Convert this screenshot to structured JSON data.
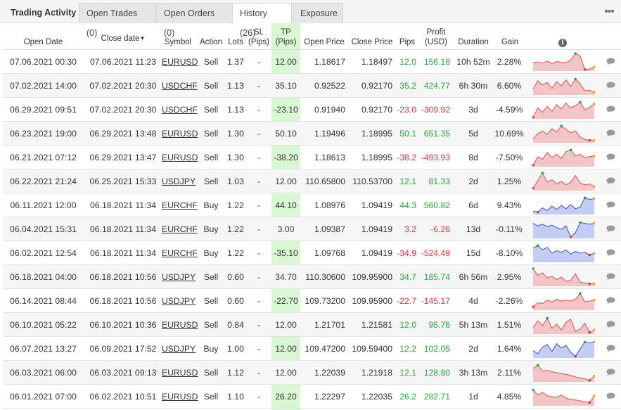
{
  "tabs": {
    "title": "Trading Activity",
    "items": [
      {
        "label": "Open Trades (0)",
        "active": false
      },
      {
        "label": "Open Orders (0)",
        "active": false
      },
      {
        "label": "History (26)",
        "active": true
      },
      {
        "label": "Exposure",
        "active": false
      }
    ],
    "more_icon": "more-dots-icon"
  },
  "columns": {
    "open_date": "Open Date",
    "close_date": "Close date",
    "sort_indicator": "▼",
    "symbol": "Symbol",
    "action": "Action",
    "lots": "Lots",
    "sl_1": "SL",
    "sl_2": "(Pips)",
    "tp_1": "TP",
    "tp_2": "(Pips)",
    "open_price": "Open Price",
    "close_price": "Close Price",
    "pips": "Pips",
    "profit_1": "Profit",
    "profit_2": "(USD)",
    "duration": "Duration",
    "gain": "Gain",
    "info_icon": "info-icon"
  },
  "colors": {
    "positive": "#2aa73a",
    "negative": "#e0393e",
    "tp_column_bg": "#d9f7d2",
    "sell_spark_line": "#d9534f",
    "sell_spark_fill": "#f2c6c6",
    "buy_spark_line": "#3a4fd1",
    "buy_spark_fill": "#c4cef2"
  },
  "rows": [
    {
      "open_date": "07.06.2021 00:30",
      "close_date": "07.06.2021 11:23",
      "symbol": "EURUSD",
      "action": "Sell",
      "lots": "1.37",
      "sl": "-",
      "tp": "12.00",
      "open_price": "1.18617",
      "close_price": "1.18497",
      "pips": "12.0",
      "profit": "156.18",
      "duration": "10h 52m",
      "gain": "2.28%",
      "sign": "pos",
      "spark": [
        0.45,
        0.5,
        0.42,
        0.55,
        0.4,
        0.52,
        0.48,
        0.46,
        0.6,
        1.0,
        0.85,
        0.05,
        0.08,
        0.2
      ]
    },
    {
      "open_date": "07.02.2021 14:00",
      "close_date": "07.02.2021 20:30",
      "symbol": "USDCHF",
      "action": "Sell",
      "lots": "1.13",
      "sl": "-",
      "tp": "35.10",
      "open_price": "0.92522",
      "close_price": "0.92170",
      "pips": "35.2",
      "profit": "424.77",
      "duration": "6h 30m",
      "gain": "6.60%",
      "sign": "pos",
      "spark": [
        0.3,
        0.8,
        0.55,
        0.7,
        0.35,
        0.75,
        0.5,
        0.85,
        0.45,
        0.9,
        0.6,
        0.2,
        0.25,
        0.1
      ]
    },
    {
      "open_date": "06.29.2021 09:51",
      "close_date": "07.02.2021 20:30",
      "symbol": "USDCHF",
      "action": "Sell",
      "lots": "1.13",
      "sl": "-",
      "tp": "-23.10",
      "open_price": "0.91940",
      "close_price": "0.92170",
      "pips": "-23.0",
      "profit": "-309.92",
      "duration": "3d",
      "gain": "-4.59%",
      "sign": "neg",
      "spark": [
        0.05,
        0.6,
        0.35,
        0.7,
        0.4,
        0.8,
        0.55,
        0.9,
        0.6,
        0.75,
        0.95,
        0.5,
        0.65,
        0.85
      ]
    },
    {
      "open_date": "06.23.2021 19:00",
      "close_date": "06.29.2021 13:48",
      "symbol": "EURUSD",
      "action": "Sell",
      "lots": "1.30",
      "sl": "-",
      "tp": "50.10",
      "open_price": "1.19496",
      "close_price": "1.18995",
      "pips": "50.1",
      "profit": "651.35",
      "duration": "5d",
      "gain": "10.69%",
      "sign": "pos",
      "spark": [
        0.2,
        0.5,
        0.65,
        0.45,
        0.8,
        0.6,
        0.95,
        0.75,
        0.55,
        0.65,
        0.3,
        0.15,
        0.1,
        0.1
      ]
    },
    {
      "open_date": "06.21.2021 07:12",
      "close_date": "06.29.2021 13:47",
      "symbol": "EURUSD",
      "action": "Sell",
      "lots": "1.30",
      "sl": "-",
      "tp": "-38.20",
      "open_price": "1.18613",
      "close_price": "1.18995",
      "pips": "-38.2",
      "profit": "-493.93",
      "duration": "8d",
      "gain": "-7.50%",
      "sign": "neg",
      "spark": [
        0.05,
        0.55,
        0.4,
        0.8,
        0.5,
        0.7,
        0.45,
        0.85,
        0.95,
        0.6,
        0.7,
        0.5,
        0.55,
        0.6
      ]
    },
    {
      "open_date": "06.22.2021 21:24",
      "close_date": "06.25.2021 15:33",
      "symbol": "USDJPY",
      "action": "Sell",
      "lots": "1.03",
      "sl": "-",
      "tp": "12.00",
      "open_price": "110.65800",
      "close_price": "110.53700",
      "pips": "12.1",
      "profit": "81.33",
      "duration": "2d",
      "gain": "1.25%",
      "sign": "pos",
      "spark": [
        0.1,
        0.55,
        1.0,
        0.45,
        0.6,
        0.35,
        0.5,
        0.3,
        0.45,
        0.85,
        0.4,
        0.3,
        0.35,
        0.2
      ]
    },
    {
      "open_date": "06.11.2021 12:00",
      "close_date": "06.18.2021 11:34",
      "symbol": "EURCHF",
      "action": "Buy",
      "lots": "1.22",
      "sl": "-",
      "tp": "44.10",
      "open_price": "1.08976",
      "close_price": "1.09419",
      "pips": "44.3",
      "profit": "560.82",
      "duration": "6d",
      "gain": "9.43%",
      "sign": "pos",
      "spark": [
        0.15,
        0.1,
        0.35,
        0.2,
        0.45,
        0.25,
        0.5,
        0.3,
        0.55,
        0.3,
        0.4,
        0.95,
        0.85,
        0.9
      ]
    },
    {
      "open_date": "06.04.2021 15:31",
      "close_date": "06.18.2021 11:34",
      "symbol": "EURCHF",
      "action": "Buy",
      "lots": "1.22",
      "sl": "-",
      "tp": "3.00",
      "open_price": "1.09387",
      "close_price": "1.09419",
      "pips": "3.2",
      "profit": "-6.26",
      "duration": "13d",
      "gain": "-0.11%",
      "sign": "neg",
      "spark": [
        0.85,
        0.7,
        0.8,
        0.65,
        0.75,
        0.6,
        0.5,
        0.7,
        0.05,
        0.3,
        0.9,
        0.85,
        0.8,
        0.85
      ]
    },
    {
      "open_date": "06.02.2021 12:54",
      "close_date": "06.18.2021 11:34",
      "symbol": "EURCHF",
      "action": "Buy",
      "lots": "1.22",
      "sl": "-",
      "tp": "-35.10",
      "open_price": "1.09768",
      "close_price": "1.09419",
      "pips": "-34.9",
      "profit": "-524.49",
      "duration": "15d",
      "gain": "-8.10%",
      "sign": "neg",
      "spark": [
        0.8,
        0.95,
        0.7,
        0.85,
        0.5,
        0.65,
        0.55,
        0.7,
        0.45,
        0.6,
        0.5,
        0.55,
        0.4,
        0.5
      ]
    },
    {
      "open_date": "06.18.2021 04:00",
      "close_date": "06.18.2021 10:56",
      "symbol": "USDJPY",
      "action": "Sell",
      "lots": "0.60",
      "sl": "-",
      "tp": "34.70",
      "open_price": "110.30600",
      "close_price": "109.95900",
      "pips": "34.7",
      "profit": "185.74",
      "duration": "6h 56m",
      "gain": "2.95%",
      "sign": "pos",
      "spark": [
        1.0,
        0.6,
        0.75,
        0.45,
        0.55,
        0.35,
        0.5,
        0.25,
        0.3,
        0.7,
        0.2,
        0.15,
        0.1,
        0.1
      ]
    },
    {
      "open_date": "06.14.2021 08:44",
      "close_date": "06.18.2021 10:56",
      "symbol": "USDJPY",
      "action": "Sell",
      "lots": "0.60",
      "sl": "-",
      "tp": "-22.70",
      "open_price": "109.73200",
      "close_price": "109.95900",
      "pips": "-22.7",
      "profit": "-145.17",
      "duration": "4d",
      "gain": "-2.26%",
      "sign": "neg",
      "spark": [
        0.15,
        0.4,
        0.35,
        0.55,
        0.45,
        0.6,
        0.5,
        0.55,
        0.5,
        0.6,
        0.95,
        0.45,
        0.5,
        0.55
      ]
    },
    {
      "open_date": "06.10.2021 05:22",
      "close_date": "06.10.2021 10:36",
      "symbol": "EURUSD",
      "action": "Sell",
      "lots": "0.84",
      "sl": "-",
      "tp": "12.00",
      "open_price": "1.21701",
      "close_price": "1.21581",
      "pips": "12.0",
      "profit": "95.76",
      "duration": "5h 13m",
      "gain": "1.51%",
      "sign": "pos",
      "spark": [
        0.35,
        0.75,
        0.45,
        0.9,
        0.3,
        0.55,
        0.2,
        0.65,
        0.85,
        0.1,
        0.25,
        0.6,
        0.05,
        0.2
      ]
    },
    {
      "open_date": "06.07.2021 13:27",
      "close_date": "06.09.2021 17:52",
      "symbol": "USDJPY",
      "action": "Buy",
      "lots": "1.00",
      "sl": "-",
      "tp": "12.00",
      "open_price": "109.47200",
      "close_price": "109.59400",
      "pips": "12.2",
      "profit": "102.05",
      "duration": "2d",
      "gain": "1.64%",
      "sign": "pos",
      "spark": [
        0.4,
        0.2,
        0.6,
        0.75,
        0.35,
        0.8,
        0.55,
        0.7,
        0.3,
        0.05,
        0.5,
        0.9,
        0.85,
        0.9
      ]
    },
    {
      "open_date": "06.03.2021 06:00",
      "close_date": "06.03.2021 09:13",
      "symbol": "EURUSD",
      "action": "Sell",
      "lots": "1.12",
      "sl": "-",
      "tp": "12.00",
      "open_price": "1.22039",
      "close_price": "1.21918",
      "pips": "12.1",
      "profit": "128.80",
      "duration": "3h 13m",
      "gain": "2.11%",
      "sign": "pos",
      "spark": [
        0.75,
        0.95,
        0.6,
        0.65,
        0.55,
        0.5,
        0.45,
        0.4,
        0.35,
        0.25,
        0.2,
        0.15,
        0.05,
        0.3
      ]
    },
    {
      "open_date": "06.01.2021 07:00",
      "close_date": "06.02.2021 10:51",
      "symbol": "EURUSD",
      "action": "Sell",
      "lots": "1.10",
      "sl": "-",
      "tp": "26.20",
      "open_price": "1.22297",
      "close_price": "1.22035",
      "pips": "26.2",
      "profit": "282.71",
      "duration": "1d",
      "gain": "4.85%",
      "sign": "pos",
      "spark": [
        0.9,
        0.6,
        0.75,
        0.55,
        0.5,
        0.45,
        0.6,
        0.4,
        0.35,
        0.3,
        0.25,
        0.2,
        0.15,
        0.55
      ]
    }
  ]
}
